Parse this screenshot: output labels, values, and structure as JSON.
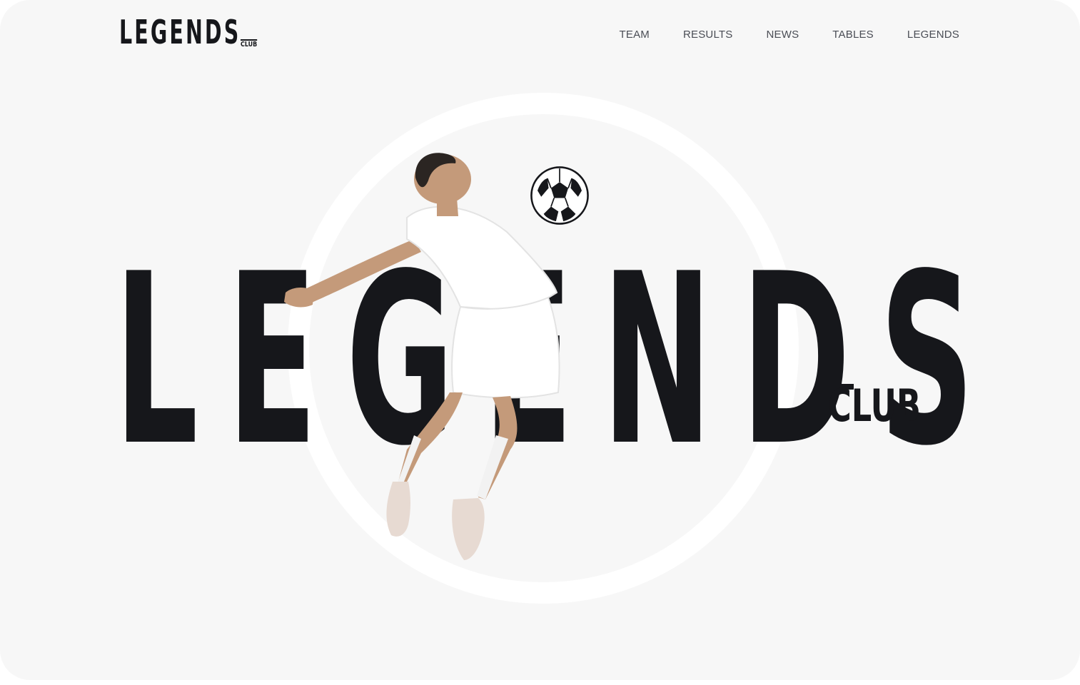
{
  "header": {
    "logo": {
      "word": "LEGENDS",
      "sub": "CLUB"
    },
    "nav": [
      {
        "label": "TEAM"
      },
      {
        "label": "RESULTS"
      },
      {
        "label": "NEWS"
      },
      {
        "label": "TABLES"
      },
      {
        "label": "LEGENDS"
      }
    ]
  },
  "hero": {
    "word": "LEGENDS",
    "sub": "CLUB"
  },
  "colors": {
    "background": "#f7f7f7",
    "ink": "#16171b",
    "nav_text": "#4a4d55",
    "ring": "#ffffff"
  },
  "icons": {
    "ball": "soccer-ball-icon"
  }
}
